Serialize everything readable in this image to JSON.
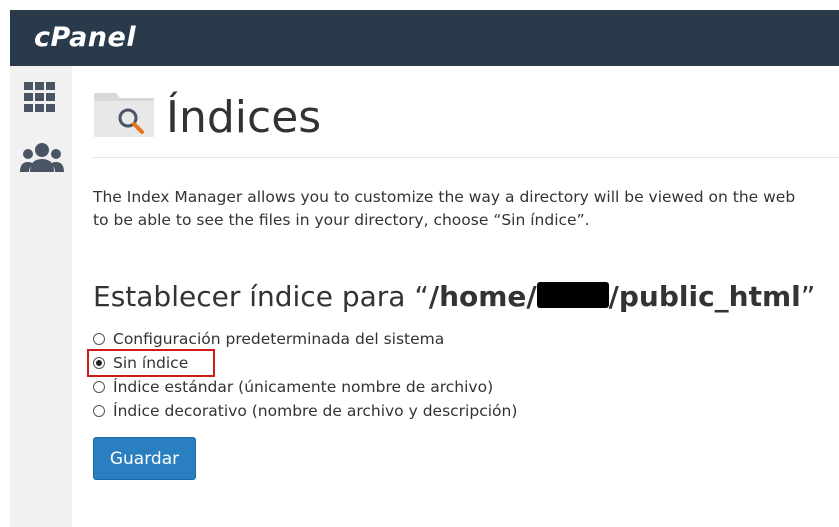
{
  "header": {
    "logo_text": "cPanel"
  },
  "sidebar": {
    "items": [
      {
        "icon": "grid-icon"
      },
      {
        "icon": "users-icon"
      }
    ]
  },
  "page": {
    "title": "Índices",
    "description_line1": "The Index Manager allows you to customize the way a directory will be viewed on the web",
    "description_line2": "to be able to see the files in your directory, choose “Sin índice”.",
    "section_prefix": "Establecer índice para “",
    "path_start": "/home/",
    "path_end": "/public_html",
    "section_suffix": "”"
  },
  "options": {
    "items": [
      {
        "label": "Configuración predeterminada del sistema",
        "checked": false
      },
      {
        "label": "Sin índice",
        "checked": true
      },
      {
        "label": "Índice estándar (únicamente nombre de archivo)",
        "checked": false
      },
      {
        "label": "Índice decorativo (nombre de archivo y descripción)",
        "checked": false
      }
    ]
  },
  "actions": {
    "save_label": "Guardar"
  },
  "colors": {
    "topbar": "#293a4a",
    "button": "#2a7fc0",
    "highlight": "#d11a1a"
  }
}
